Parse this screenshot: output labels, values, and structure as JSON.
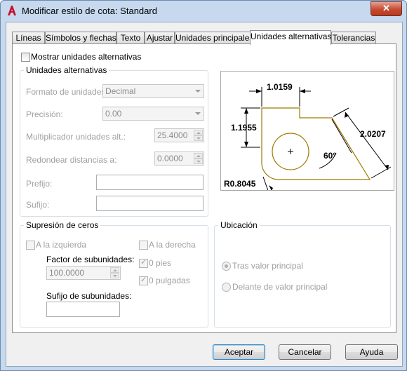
{
  "window": {
    "title": "Modificar estilo de cota: Standard",
    "close_label": "✕"
  },
  "tabs": [
    {
      "label": "Líneas"
    },
    {
      "label": "Símbolos y flechas"
    },
    {
      "label": "Texto"
    },
    {
      "label": "Ajustar"
    },
    {
      "label": "Unidades principales"
    },
    {
      "label": "Unidades alternativas"
    },
    {
      "label": "Tolerancias"
    }
  ],
  "show_alt": {
    "label": "Mostrar unidades alternativas",
    "checked": false
  },
  "alt_units": {
    "group_title": "Unidades alternativas",
    "format_label": "Formato de unidades:",
    "format_value": "Decimal",
    "precision_label": "Precisión:",
    "precision_value": "0.00",
    "multiplier_label": "Multiplicador unidades alt.:",
    "multiplier_value": "25.4000",
    "round_label": "Redondear distancias a:",
    "round_value": "0.0000",
    "prefix_label": "Prefijo:",
    "prefix_value": "",
    "suffix_label": "Sufijo:",
    "suffix_value": ""
  },
  "preview": {
    "dim_top": "1.0159",
    "dim_left": "1.1955",
    "dim_right": "2.0207",
    "angle": "60°",
    "radius": "R0.8045"
  },
  "zero_suppression": {
    "group_title": "Supresión de ceros",
    "left_label": "A la izquierda",
    "right_label": "A la derecha",
    "subunit_factor_label": "Factor de subunidades:",
    "subunit_factor_value": "100.0000",
    "subunit_suffix_label": "Sufijo de subunidades:",
    "subunit_suffix_value": "",
    "feet_label": "0 pies",
    "inches_label": "0 pulgadas"
  },
  "placement": {
    "group_title": "Ubicación",
    "after_label": "Tras valor principal",
    "before_label": "Delante de valor principal"
  },
  "buttons": {
    "accept": "Aceptar",
    "cancel": "Cancelar",
    "help": "Ayuda"
  },
  "colors": {
    "window_frame": "#c7d9ee",
    "close_button": "#c44a30",
    "drawing_outline": "#a07a00",
    "app_icon": "#c8102e"
  }
}
